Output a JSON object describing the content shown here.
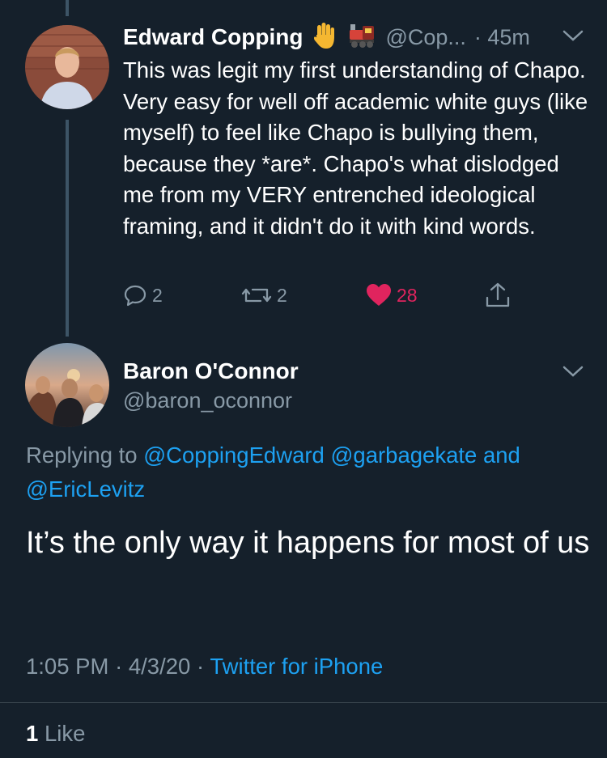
{
  "tweet1": {
    "name": "Edward Copping",
    "handle": "@Cop...",
    "time": "· 45m",
    "text": "This was legit my first understanding of Chapo. Very easy for well off academic white guys (like myself) to feel like Chapo is bullying them, because they *are*. Chapo's what dislodged me from my VERY entrenched ideological framing, and it didn't do it with kind words.",
    "replies": "2",
    "retweets": "2",
    "likes": "28",
    "colors": {
      "like": "#e0245e"
    }
  },
  "tweet2": {
    "name": "Baron O'Connor",
    "handle": "@baron_oconnor",
    "replying_prefix": "Replying to",
    "replying_users": [
      "@CoppingEdward",
      "@garbagekate",
      "@EricLevitz"
    ],
    "replying_and": "and",
    "text": "It’s the only way it happens for most of us",
    "time": "1:05 PM",
    "date": "4/3/20",
    "source": "Twitter for iPhone",
    "likes_count": "1",
    "likes_label": "Like"
  },
  "colors": {
    "background": "#15202b",
    "accent": "#1da1f2",
    "muted": "#8899a6"
  },
  "icons": [
    "raised-hand-emoji-icon",
    "train-emoji-icon",
    "chevron-down-icon",
    "reply-icon",
    "retweet-icon",
    "heart-icon",
    "share-icon"
  ]
}
